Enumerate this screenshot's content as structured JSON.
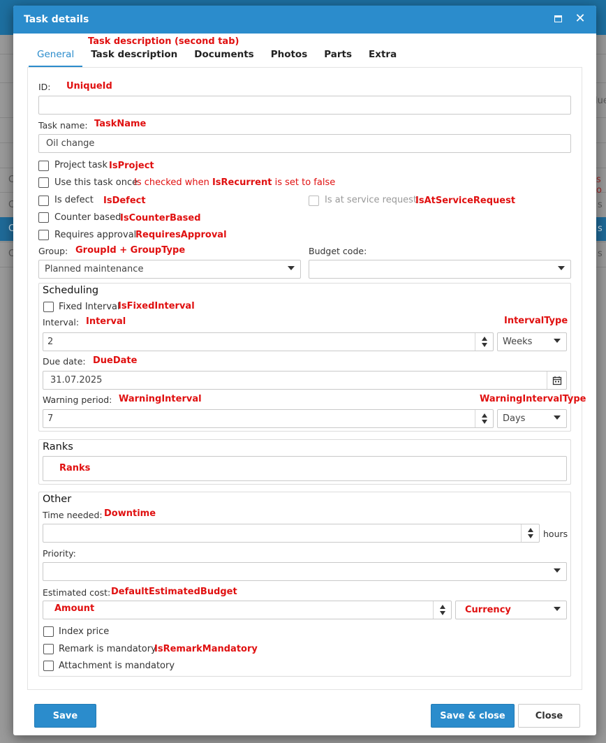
{
  "dialog": {
    "title": "Task details"
  },
  "tabs": [
    {
      "label": "General",
      "active": true
    },
    {
      "label": "Task description"
    },
    {
      "label": "Documents"
    },
    {
      "label": "Photos"
    },
    {
      "label": "Parts"
    },
    {
      "label": "Extra"
    }
  ],
  "annotations": {
    "task_description_tab": "Task description (second tab)",
    "id": "UniqueId",
    "task_name": "TaskName",
    "is_project": "IsProject",
    "use_once_pre": "Is checked when ",
    "use_once_bold": "IsRecurrent",
    "use_once_post": " is set to false",
    "is_defect": "IsDefect",
    "is_at_service_request": "IsAtServiceRequest",
    "counter_based": "IsCounterBased",
    "requires_approval": "RequiresApproval",
    "group": "GroupId + GroupType",
    "fixed_interval": "IsFixedInterval",
    "interval": "Interval",
    "interval_type": "IntervalType",
    "due_date": "DueDate",
    "warning_period": "WarningInterval",
    "warning_interval_type": "WarningIntervalType",
    "ranks": "Ranks",
    "time_needed": "Downtime",
    "estimated_cost": "DefaultEstimatedBudget",
    "amount": "Amount",
    "currency": "Currency",
    "remark_mandatory": "IsRemarkMandatory"
  },
  "general": {
    "id_label": "ID:",
    "id_value": "",
    "task_name_label": "Task name:",
    "task_name_value": "Oil change",
    "checkboxes": {
      "project_task": "Project task",
      "use_once": "Use this task once",
      "is_defect": "Is defect",
      "at_service_request": "Is at service request",
      "counter_based": "Counter based",
      "requires_approval": "Requires approval"
    },
    "group_label": "Group:",
    "group_value": "Planned maintenance",
    "budget_code_label": "Budget code:",
    "budget_code_value": ""
  },
  "scheduling": {
    "title": "Scheduling",
    "fixed_interval_label": "Fixed Interval",
    "interval_label": "Interval:",
    "interval_value": "2",
    "interval_type_value": "Weeks",
    "due_date_label": "Due date:",
    "due_date_value": "31.07.2025",
    "warning_label": "Warning period:",
    "warning_value": "7",
    "warning_type_value": "Days"
  },
  "ranks": {
    "title": "Ranks"
  },
  "other": {
    "title": "Other",
    "time_needed_label": "Time needed:",
    "time_needed_value": "",
    "hours_unit": "hours",
    "priority_label": "Priority:",
    "priority_value": "",
    "estimated_cost_label": "Estimated cost:",
    "index_price_label": "Index price",
    "remark_mandatory_label": "Remark is mandatory",
    "attachment_mandatory_label": "Attachment is mandatory"
  },
  "footer": {
    "save": "Save",
    "save_close": "Save & close",
    "close": "Close"
  },
  "background": {
    "row_texts": [
      "C",
      "C",
      "C",
      "C"
    ],
    "right_texts": [
      "lue",
      "s o",
      "s",
      "s",
      "s"
    ]
  },
  "colors": {
    "accent": "#2b8ccc",
    "annotation": "#e01010"
  }
}
